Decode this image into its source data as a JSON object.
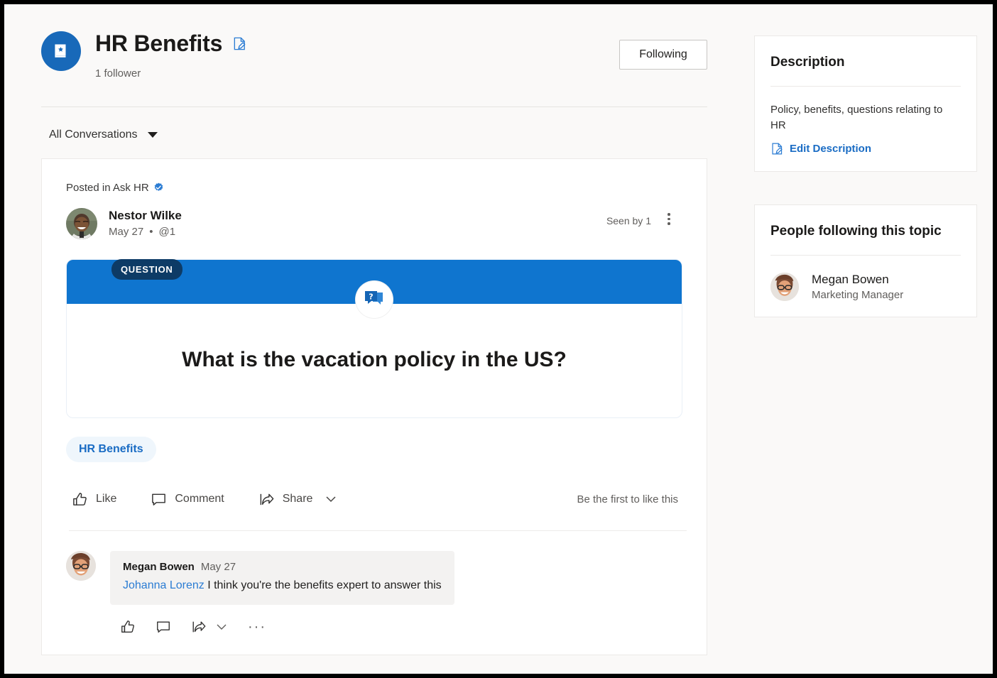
{
  "header": {
    "topic_title": "HR Benefits",
    "follower_count": "1 follower",
    "edit_title_icon": "edit-pencil-icon",
    "following_button": "Following",
    "topic_avatar_icon": "book-star-icon"
  },
  "filter": {
    "label": "All Conversations",
    "caret_icon": "chevron-down-icon"
  },
  "post": {
    "posted_in": "Posted in Ask HR",
    "verified_icon": "verified-badge-icon",
    "author_name": "Nestor Wilke",
    "date": "May 27",
    "separator": "•",
    "mentions": "@1",
    "seen_by": "Seen by 1",
    "more_icon": "more-options-icon",
    "question_badge": "QUESTION",
    "question_icon": "question-bubble-icon",
    "question_text": "What is the vacation policy in the US?",
    "topic_pill": "HR Benefits",
    "actions": [
      {
        "label": "Like",
        "icon": "thumbs-up-icon"
      },
      {
        "label": "Comment",
        "icon": "comment-bubble-icon"
      },
      {
        "label": "Share",
        "icon": "share-arrow-icon"
      }
    ],
    "share_caret_icon": "chevron-down-icon",
    "first_to_like": "Be the first to like this"
  },
  "comment": {
    "author": "Megan Bowen",
    "date": "May 27",
    "mention": "Johanna Lorenz",
    "text": " I think you're the benefits expert to answer this",
    "actions": [
      {
        "icon": "thumbs-up-icon"
      },
      {
        "icon": "comment-bubble-icon"
      },
      {
        "icon": "share-arrow-icon"
      },
      {
        "icon": "chevron-down-icon"
      },
      {
        "icon": "more-horizontal-icon"
      }
    ],
    "ellipsis": "···"
  },
  "sidebar": {
    "description_card": {
      "title": "Description",
      "text": "Policy, benefits, questions relating to HR",
      "edit_link": "Edit Description",
      "edit_icon": "edit-pencil-icon"
    },
    "followers_card": {
      "title": "People following this topic",
      "people": [
        {
          "name": "Megan Bowen",
          "role": "Marketing Manager"
        }
      ]
    }
  },
  "colors": {
    "page_background": "#faf9f8",
    "card_background": "#ffffff",
    "accent_blue": "#0f75cf",
    "badge_navy": "#0d3b66",
    "link_blue": "#1a6cc4",
    "pill_background": "#eff6fc",
    "avatar_blue": "#1869b9",
    "comment_bubble": "#f3f2f1"
  }
}
